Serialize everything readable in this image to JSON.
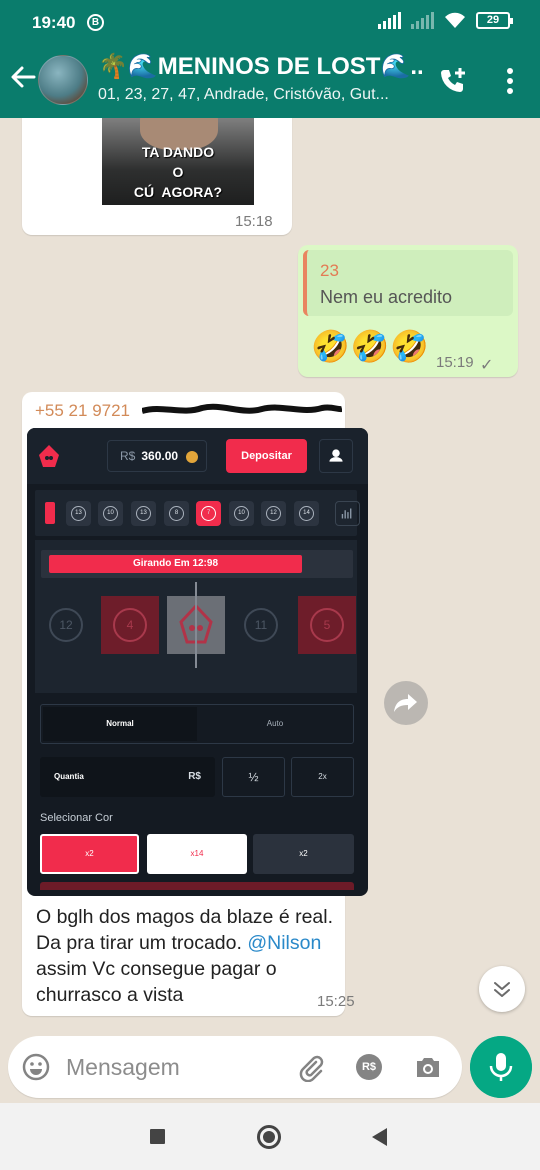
{
  "status": {
    "time": "19:40",
    "badge": "B",
    "battery": "29"
  },
  "header": {
    "title": "🌴🌊MENINOS DE LOST🌊...",
    "subtitle": "01, 23, 27, 47, Andrade, Cristóvão, Gut..."
  },
  "messages": {
    "meme": {
      "caption": "TA DANDO\nO\nCÚ  AGORA?",
      "time": "15:18"
    },
    "reply": {
      "quoted_name": "23",
      "quoted_text": "Nem eu acredito",
      "emojis": "🤣🤣🤣",
      "time": "15:19",
      "check": "✓"
    },
    "shared": {
      "sender": "+55 21 9721",
      "text_line1": "O bglh dos magos da blaze é real. Da pra tirar um trocado.",
      "mention": "@Nilson",
      "text_line2": " assim Vc consegue pagar o churrasco a vista",
      "time": "15:25"
    }
  },
  "game": {
    "currency": "R$",
    "balance": "360.00",
    "deposit_label": "Depositar",
    "history": [
      "13",
      "10",
      "13",
      "8",
      "7",
      "10",
      "12",
      "14"
    ],
    "roll_label": "Girando Em 12:98",
    "tiles": [
      "12",
      "4",
      "",
      "11",
      "5"
    ],
    "mode_normal": "Normal",
    "mode_auto": "Auto",
    "quantity_label": "Quantia",
    "quantity_currency": "R$",
    "half_label": "½",
    "double_label": "2x",
    "select_color_label": "Selecionar Cor",
    "color_red": "x2",
    "color_white": "x14",
    "color_black": "x2"
  },
  "composer": {
    "placeholder": "Mensagem",
    "rs_icon": "R$"
  },
  "colors": {
    "header": "#0a7c6c",
    "out_bubble": "#dcf8c6",
    "blaze_red": "#f12c4c",
    "mic": "#05a884"
  }
}
